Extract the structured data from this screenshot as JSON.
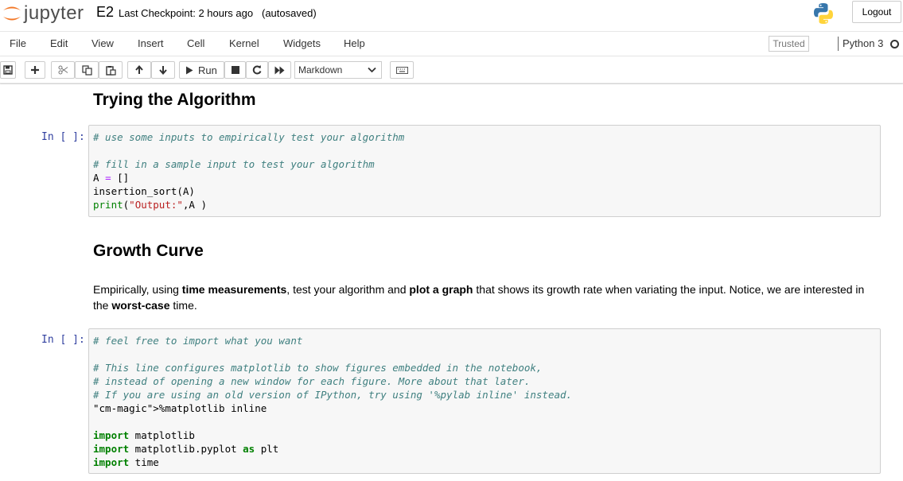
{
  "header": {
    "logo_text": "jupyter",
    "notebook_name": "E2",
    "checkpoint": "Last Checkpoint: 2 hours ago",
    "autosave": "(autosaved)",
    "logout_label": "Logout"
  },
  "menubar": {
    "items": [
      "File",
      "Edit",
      "View",
      "Insert",
      "Cell",
      "Kernel",
      "Widgets",
      "Help"
    ],
    "trusted_label": "Trusted",
    "kernel_name": "Python 3"
  },
  "toolbar": {
    "run_label": "Run",
    "cell_type": "Markdown",
    "icons": [
      "save-icon",
      "plus-icon",
      "cut-icon",
      "copy-icon",
      "paste-icon",
      "arrow-up-icon",
      "arrow-down-icon",
      "play-icon",
      "stop-icon",
      "restart-icon",
      "fast-forward-icon",
      "keyboard-icon"
    ]
  },
  "cells": {
    "heading1": "Trying the Algorithm",
    "code1_prompt": "In [ ]:",
    "code1_lines": [
      "# use some inputs to empirically test your algorithm",
      "",
      "# fill in a sample input to test your algorithm",
      "A = []",
      "insertion_sort(A)",
      "print(\"Output:\",A )"
    ],
    "heading2": "Growth Curve",
    "paragraph": {
      "t1": "Empirically, using ",
      "b1": "time measurements",
      "t2": ", test your algorithm and ",
      "b2": "plot a graph",
      "t3": " that shows its growth rate when variating the input. Notice, we are interested in the ",
      "b3": "worst-case",
      "t4": " time."
    },
    "code2_prompt": "In [ ]:",
    "code2_lines": [
      "# feel free to import what you want",
      "",
      "# This line configures matplotlib to show figures embedded in the notebook,",
      "# instead of opening a new window for each figure. More about that later.",
      "# If you are using an old version of IPython, try using '%pylab inline' instead.",
      "%matplotlib inline",
      "",
      "import matplotlib",
      "import matplotlib.pyplot as plt",
      "import time"
    ]
  },
  "colors": {
    "prompt": "#303f9f",
    "comment": "#408080",
    "keyword": "#008000",
    "string": "#ba2121",
    "magic": "#aa22ff",
    "jupyter_orange": "#f37726"
  }
}
